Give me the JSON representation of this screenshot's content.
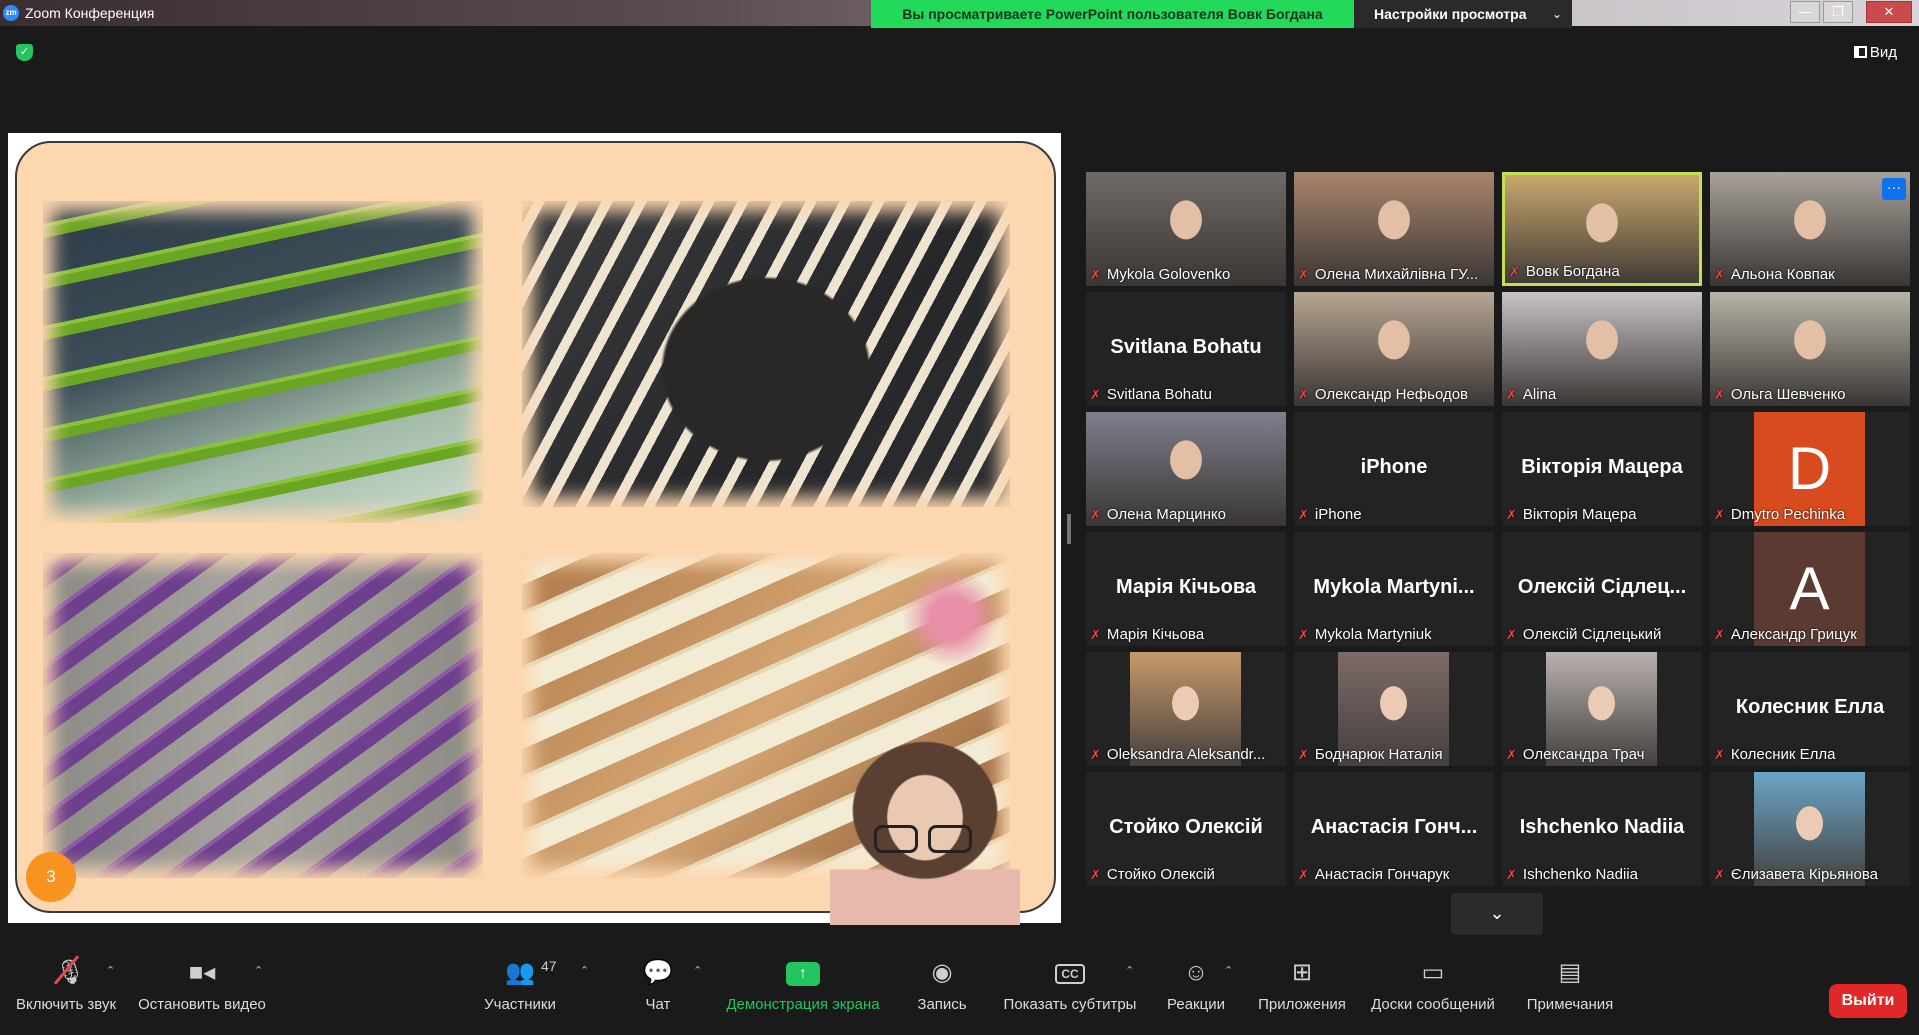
{
  "window": {
    "title": "Zoom Конференция",
    "minimize": "—",
    "maximize": "❐",
    "close": "✕"
  },
  "share_banner": {
    "text": "Вы просматриваете PowerPoint пользователя Вовк Богдана",
    "view_settings": "Настройки просмотра",
    "view_settings_icon": "chevron-down-icon"
  },
  "top_right": {
    "view_label": "Вид"
  },
  "slide": {
    "number": "3"
  },
  "participants": [
    {
      "name": "Mykola Golovenko",
      "type": "video",
      "tone": "#6f6a66"
    },
    {
      "name": "Олена Михайлівна ГУ...",
      "type": "video",
      "tone": "#a9856c"
    },
    {
      "name": "Вовк Богдана",
      "type": "video",
      "tone": "#c9a86e",
      "active": true
    },
    {
      "name": "Альона Ковпак",
      "type": "video",
      "tone": "#a8a29a",
      "more": "···"
    },
    {
      "name": "Svitlana Bohatu",
      "type": "name",
      "big": "Svitlana Bohatu"
    },
    {
      "name": "Олександр   Нефьодов",
      "type": "video",
      "tone": "#b7a593"
    },
    {
      "name": "Alina",
      "type": "video",
      "tone": "#c8c3c5"
    },
    {
      "name": "Ольга Шевченко",
      "type": "video",
      "tone": "#b9b4a8"
    },
    {
      "name": "Олена Марцинко",
      "type": "video",
      "tone": "#7f7e8c"
    },
    {
      "name": "iPhone",
      "type": "name",
      "big": "iPhone"
    },
    {
      "name": "Вікторія Мацера",
      "type": "name",
      "big": "Вікторія Мацера"
    },
    {
      "name": "Dmytro Pechinka",
      "type": "letter",
      "letter": "D",
      "color": "#d84b1e"
    },
    {
      "name": "Марія Кічьова",
      "type": "name",
      "big": "Марія Кічьова"
    },
    {
      "name": "Mykola Martyniuk",
      "type": "name",
      "big": "Mykola  Martyni..."
    },
    {
      "name": "Олексій Сідлецький",
      "type": "name",
      "big": "Олексій Сідлец..."
    },
    {
      "name": "Александр Грицук",
      "type": "letter",
      "letter": "A",
      "color": "#5b3a32"
    },
    {
      "name": "Oleksandra Aleksandr...",
      "type": "photo",
      "tone": "#c79a6a"
    },
    {
      "name": "Боднарюк Наталія",
      "type": "photo",
      "tone": "#7e6a68"
    },
    {
      "name": "Олександра Трач",
      "type": "photo",
      "tone": "#b9b2ad"
    },
    {
      "name": "Колесник Елла",
      "type": "name",
      "big": "Колесник Елла"
    },
    {
      "name": "Стойко Олексій",
      "type": "name",
      "big": "Стойко Олексій"
    },
    {
      "name": "Анастасія Гончарук",
      "type": "name",
      "big": "Анастасія Гонч..."
    },
    {
      "name": "Ishchenko Nadiia",
      "type": "name",
      "big": "Ishchenko Nadiia"
    },
    {
      "name": "Єлизавета Кірьянова",
      "type": "photo",
      "tone": "#6aa6c7"
    }
  ],
  "toolbar": {
    "unmute": "Включить звук",
    "stop_video": "Остановить видео",
    "participants": "Участники",
    "participants_count": "47",
    "chat": "Чат",
    "share": "Демонстрация экрана",
    "record": "Запись",
    "captions": "Показать субтитры",
    "reactions": "Реакции",
    "apps": "Приложения",
    "whiteboards": "Доски сообщений",
    "notes": "Примечания",
    "leave": "Выйти",
    "cc_text": "CC"
  },
  "colors": {
    "accent_green": "#22c55e",
    "banner_green": "#23d959",
    "leave_red": "#e02828",
    "mic_red": "#e5484d",
    "active_border": "#c6e04d"
  }
}
